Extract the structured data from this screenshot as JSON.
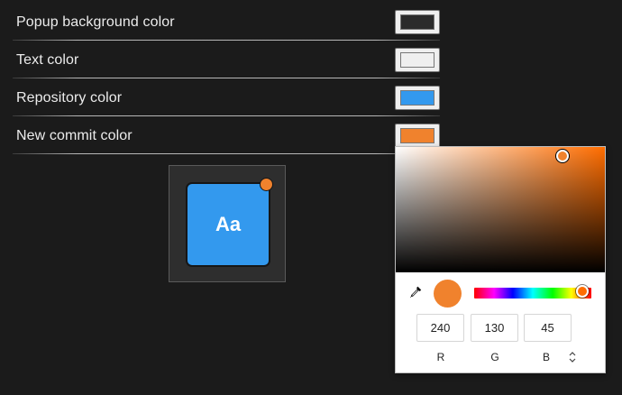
{
  "settings": {
    "rows": [
      {
        "label": "Popup background color",
        "color": "#2b2b2b"
      },
      {
        "label": "Text color",
        "color": "#efefef"
      },
      {
        "label": "Repository color",
        "color": "#3399ee"
      },
      {
        "label": "New commit color",
        "color": "#f0822d"
      }
    ]
  },
  "preview": {
    "sample_text": "Aa",
    "tile_color": "#3399ee",
    "dot_color": "#f0822d"
  },
  "picker": {
    "hue_color": "#ff6d00",
    "current_color": "#f0822d",
    "r": "240",
    "g": "130",
    "b": "45",
    "labels": {
      "r": "R",
      "g": "G",
      "b": "B"
    },
    "mode_toggle_icon": "up-down-arrows-icon"
  }
}
